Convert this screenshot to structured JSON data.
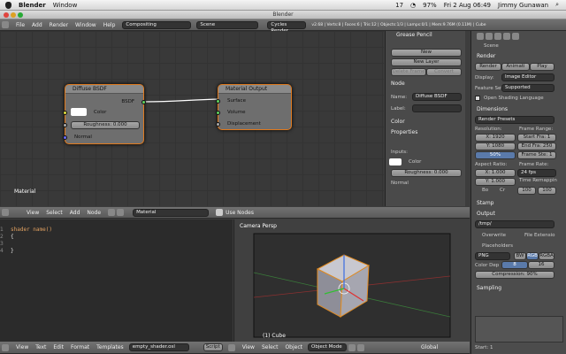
{
  "macbar": {
    "apple": "",
    "app": "Blender",
    "menu": "Window",
    "battery": "97%",
    "datetime": "Fri 2 Aug 06:49",
    "user": "Jimmy Gunawan",
    "badge": "17"
  },
  "window_title": "Blender",
  "top_header": {
    "menus": [
      "File",
      "Add",
      "Render",
      "Window",
      "Help"
    ],
    "screen": "Compositing",
    "scene": "Scene",
    "engine": "Cycles Render",
    "stats": "v2.68 | Verts:8 | Faces:6 | Tris:12 | Objects:1/3 | Lamps:0/1 | Mem:9.76M (0.11M) | Cube"
  },
  "node_editor": {
    "label": "Material",
    "diffuse": {
      "title": "Diffuse BSDF",
      "out": "BSDF",
      "color": "Color",
      "roughness": "Roughness: 0.000",
      "normal": "Normal"
    },
    "output": {
      "title": "Material Output",
      "surface": "Surface",
      "volume": "Volume",
      "displacement": "Displacement"
    }
  },
  "node_props": {
    "grease": "Grease Pencil",
    "new": "New",
    "new_layer": "New Layer",
    "delete_frame": "Delete Frame",
    "convert": "Convert",
    "node": "Node",
    "name_label": "Name:",
    "name_val": "Diffuse BSDF",
    "label_label": "Label:",
    "color": "Color",
    "properties": "Properties",
    "inputs": "Inputs:",
    "color2": "Color",
    "roughness": "Roughness: 0.000",
    "normal": "Normal"
  },
  "node_header": {
    "menus": [
      "View",
      "Select",
      "Add",
      "Node"
    ],
    "material": "Material",
    "use_nodes": "Use Nodes"
  },
  "text_editor": {
    "lines": [
      "shader name()",
      "{",
      "",
      "}"
    ],
    "line_nums": [
      "1",
      "2",
      "3",
      "4"
    ],
    "footer": {
      "menus": [
        "View",
        "Text",
        "Edit",
        "Format",
        "Templates"
      ],
      "file": "empty_shader.osl",
      "script": "Script"
    }
  },
  "viewport": {
    "label": "Camera Persp",
    "obj": "(1) Cube",
    "footer": {
      "menus": [
        "View",
        "Select",
        "Object"
      ],
      "mode": "Object Mode",
      "global": "Global"
    }
  },
  "props_panel": {
    "scene": "Scene",
    "render": "Render",
    "render_btn": "Render",
    "anim_btn": "Animati",
    "play_btn": "Play",
    "display_label": "Display:",
    "display": "Image Editor",
    "feature_label": "Feature Set:",
    "feature": "Supported",
    "osl": "Open Shading Language",
    "dimensions": "Dimensions",
    "presets": "Render Presets",
    "resolution": "Resolution:",
    "frame_range": "Frame Range:",
    "x": "X: 1920",
    "y": "Y: 1080",
    "pct": "50%",
    "start": "Start Fra: 1",
    "end": "End Fra: 250",
    "step": "Frame Ste: 1",
    "aspect": "Aspect Ratio:",
    "frate": "Frame Rate:",
    "ax": "X: 1.000",
    "ay": "Y: 1.000",
    "fps": "24 fps",
    "remap": "Time Remappin",
    "bo": "Bo",
    "cr": "Cr",
    "r100a": "100",
    "r100b": "100",
    "stamp": "Stamp",
    "output": "Output",
    "path": "/tmp/",
    "overwrite": "Overwrite",
    "file_ext": "File Extensio",
    "placeholders": "Placeholders",
    "png": "PNG",
    "bw": "BW",
    "rgb": "RGB",
    "rgba": "RGBA",
    "depth_label": "Color Dep",
    "d8": "8",
    "d16": "16",
    "compression": "Compression: 90%",
    "sampling": "Sampling",
    "start_label": "Start: 1"
  }
}
